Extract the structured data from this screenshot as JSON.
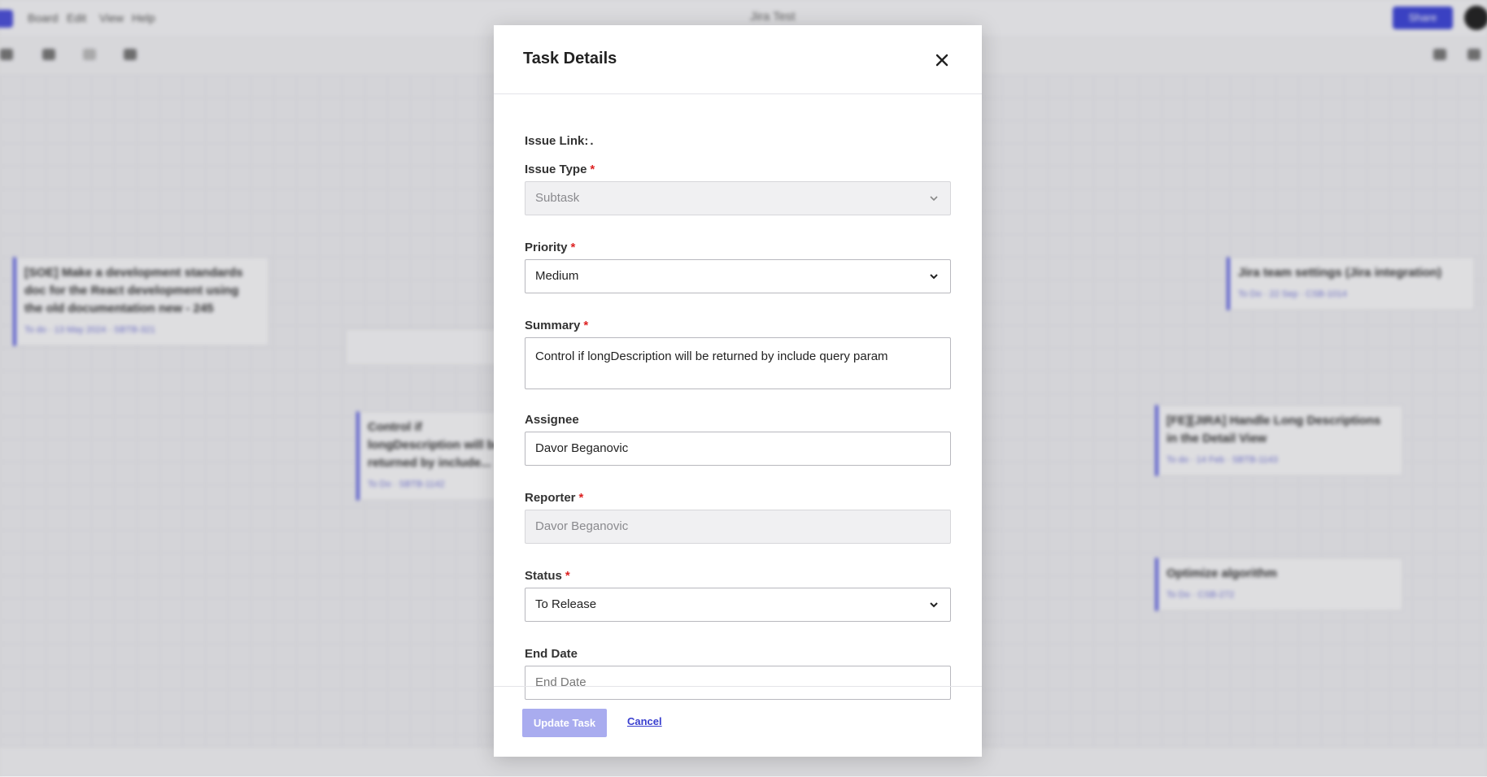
{
  "background": {
    "menu": [
      "Board",
      "Edit",
      "View",
      "Help"
    ],
    "board_title": "Jira Test",
    "share_label": "Share",
    "cards": [
      {
        "title": "[SOE] Make a development standards doc for the React development using the old documentation new - 245",
        "meta": "To do · 13 May 2024 · SBTB-321"
      },
      {
        "title": "Control if longDescription will be returned by include...",
        "meta": "To Do · SBTB-1142"
      },
      {
        "title": "Jira team settings (Jira integration)",
        "meta": "To Do · 22 Sep · CSB-1014"
      },
      {
        "title": "[FE][JIRA] Handle Long Descriptions in the Detail View",
        "meta": "To do · 14 Feb · SBTB-1143"
      },
      {
        "title": "Optimize algorithm",
        "meta": "To Do · CSB-272"
      }
    ]
  },
  "modal": {
    "title": "Task Details",
    "issue_link_label": "Issue Link:",
    "issue_link_value": ".",
    "issue_type": {
      "label": "Issue Type",
      "value": "Subtask"
    },
    "priority": {
      "label": "Priority",
      "value": "Medium"
    },
    "summary": {
      "label": "Summary",
      "value": "Control if longDescription will be returned by include query param"
    },
    "assignee": {
      "label": "Assignee",
      "value": "Davor Beganovic"
    },
    "reporter": {
      "label": "Reporter",
      "value": "Davor Beganovic"
    },
    "status": {
      "label": "Status",
      "value": "To Release"
    },
    "end_date": {
      "label": "End Date",
      "placeholder": "End Date"
    },
    "required_mark": "*",
    "update_button": "Update Task",
    "cancel_link": "Cancel"
  },
  "colors": {
    "accent": "#3a3fcf",
    "update_button_disabled": "#a9acef",
    "required": "#d22222"
  },
  "icons": {
    "close": "close-icon",
    "chevron": "chevron-down-icon"
  }
}
